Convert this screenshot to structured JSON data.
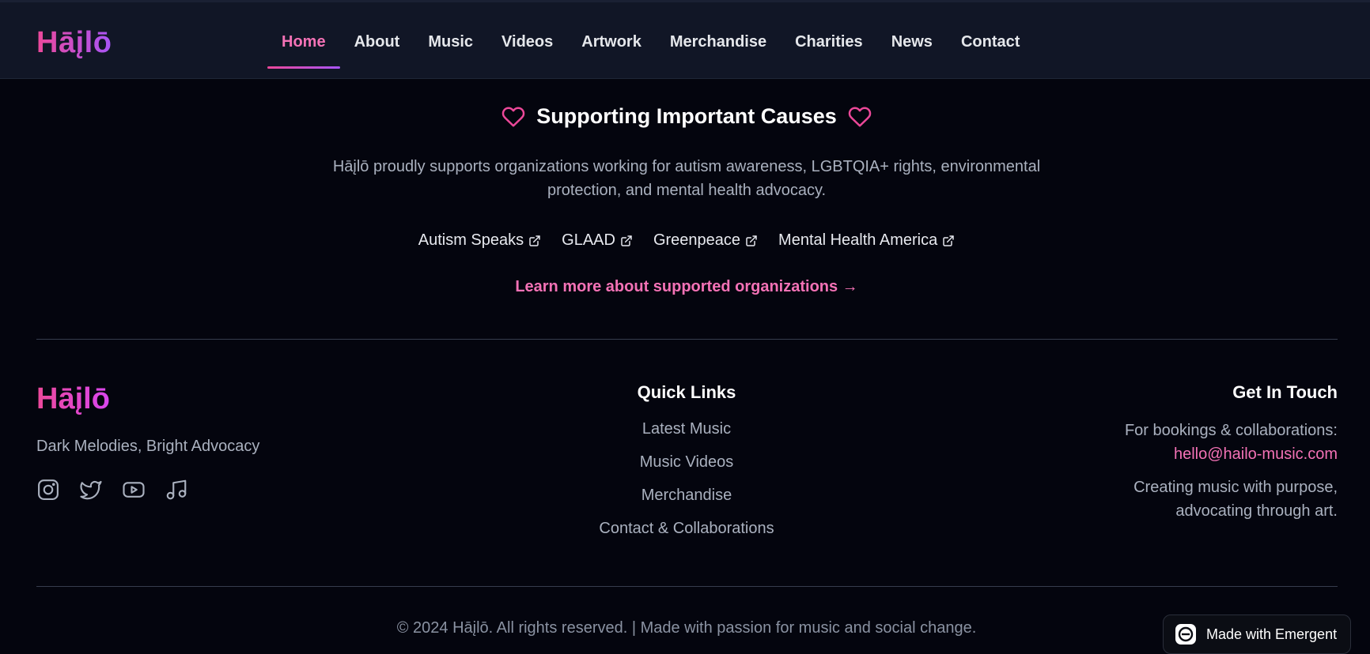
{
  "brand": {
    "logo": "Hāįlō"
  },
  "nav": {
    "items": [
      {
        "label": "Home",
        "active": true
      },
      {
        "label": "About"
      },
      {
        "label": "Music"
      },
      {
        "label": "Videos"
      },
      {
        "label": "Artwork"
      },
      {
        "label": "Merchandise"
      },
      {
        "label": "Charities"
      },
      {
        "label": "News"
      },
      {
        "label": "Contact"
      }
    ]
  },
  "causes": {
    "title": "Supporting Important Causes",
    "description": "Hāįlō proudly supports organizations working for autism awareness, LGBTQIA+ rights, environmental protection, and mental health advocacy.",
    "organizations": [
      "Autism Speaks",
      "GLAAD",
      "Greenpeace",
      "Mental Health America"
    ],
    "learn_more": "Learn more about supported organizations →"
  },
  "footer": {
    "logo": "Hāįlō",
    "tagline": "Dark Melodies, Bright Advocacy",
    "socials": [
      "instagram-icon",
      "twitter-icon",
      "youtube-icon",
      "music-note-icon"
    ],
    "quick_links": {
      "heading": "Quick Links",
      "items": [
        "Latest Music",
        "Music Videos",
        "Merchandise",
        "Contact & Collaborations"
      ]
    },
    "get_in_touch": {
      "heading": "Get In Touch",
      "bookings_text": "For bookings & collaborations:",
      "email": "hello@hailo-music.com",
      "mission_line1": "Creating music with purpose,",
      "mission_line2": "advocating through art."
    },
    "copyright": "© 2024 Hāįlō. All rights reserved. | Made with passion for music and social change."
  },
  "badge": {
    "label": "Made with Emergent"
  },
  "colors": {
    "accent_pink": "#f472b6",
    "accent_purple": "#a855f7",
    "background": "#04050e",
    "header_bg": "#111626"
  }
}
